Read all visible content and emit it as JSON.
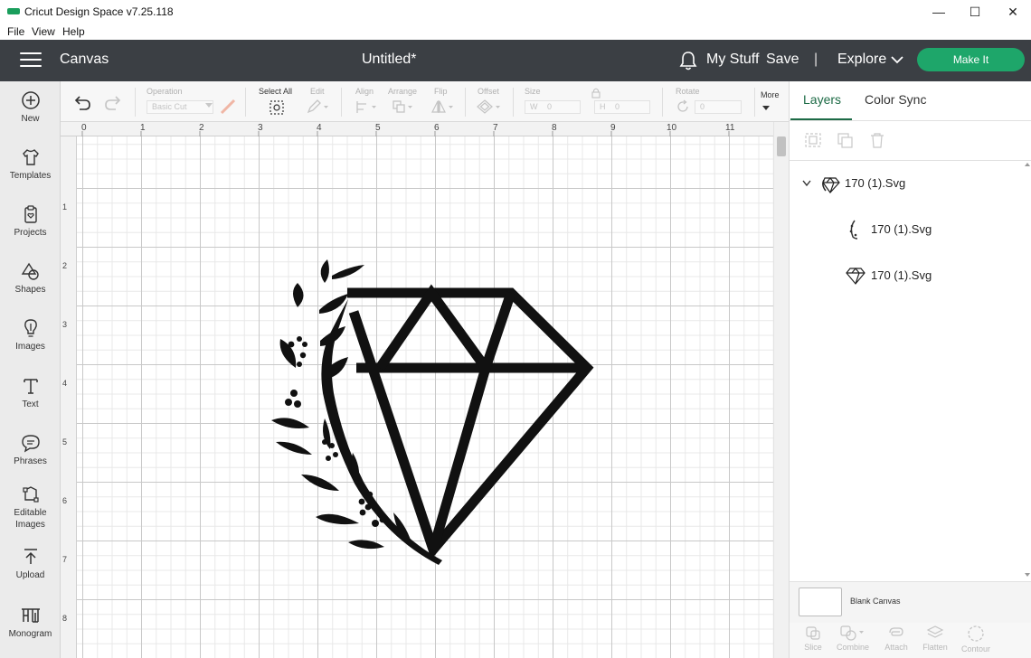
{
  "window": {
    "title": "Cricut Design Space  v7.25.118",
    "minimize": "—",
    "maximize": "☐",
    "close": "✕"
  },
  "menu": [
    "File",
    "View",
    "Help"
  ],
  "header": {
    "section": "Canvas",
    "doc_title": "Untitled*",
    "my_stuff": "My Stuff",
    "save": "Save",
    "separator": "|",
    "explore": "Explore",
    "make_it": "Make It",
    "accent": "#1ea66a"
  },
  "sidebar": [
    {
      "label": "New",
      "icon": "plus-circle-icon"
    },
    {
      "label": "Templates",
      "icon": "shirt-icon"
    },
    {
      "label": "Projects",
      "icon": "clipboard-heart-icon"
    },
    {
      "label": "Shapes",
      "icon": "shapes-icon"
    },
    {
      "label": "Images",
      "icon": "lightbulb-icon"
    },
    {
      "label": "Text",
      "icon": "text-t-icon"
    },
    {
      "label": "Phrases",
      "icon": "speech-bubble-icon"
    },
    {
      "label": "Editable Images",
      "icon": "editable-image-icon"
    },
    {
      "label": "Upload",
      "icon": "upload-icon"
    },
    {
      "label": "Monogram",
      "icon": "monogram-icon"
    }
  ],
  "toolbar": {
    "operation_label": "Operation",
    "operation_value": "Basic Cut",
    "select_all": "Select All",
    "edit": "Edit",
    "align": "Align",
    "arrange": "Arrange",
    "flip": "Flip",
    "offset": "Offset",
    "size": "Size",
    "w": "W",
    "w_value": "0",
    "h": "H",
    "h_value": "0",
    "rotate": "Rotate",
    "rotate_value": "0",
    "more": "More"
  },
  "rulers": {
    "top": [
      "0",
      "1",
      "2",
      "3",
      "4",
      "5",
      "6",
      "7",
      "8",
      "9",
      "10",
      "11"
    ],
    "left": [
      "1",
      "2",
      "3",
      "4",
      "5",
      "6",
      "7",
      "8"
    ]
  },
  "panel": {
    "tab_layers": "Layers",
    "tab_color_sync": "Color Sync",
    "group_name": "170 (1).Svg",
    "layers": [
      "170 (1).Svg",
      "170 (1).Svg"
    ],
    "blank_canvas": "Blank Canvas",
    "bottom_tools": [
      "Slice",
      "Combine",
      "Attach",
      "Flatten",
      "Contour"
    ]
  }
}
